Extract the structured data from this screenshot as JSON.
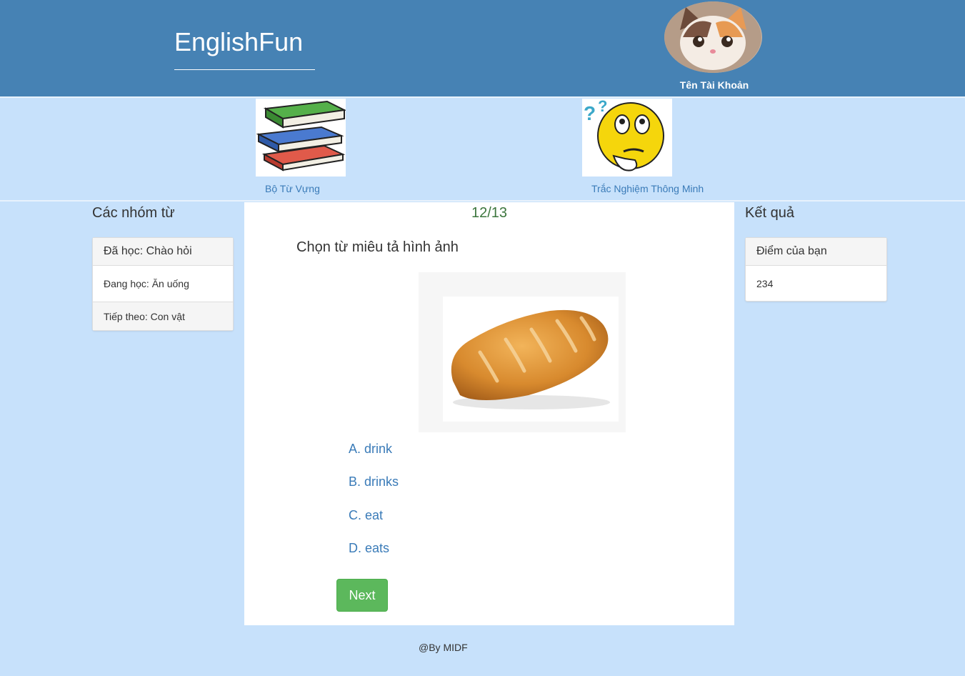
{
  "header": {
    "brand": "EnglishFun",
    "account_name": "Tên Tài Khoản"
  },
  "nav": {
    "vocab_label": "Bộ Từ Vựng",
    "quiz_label": "Trắc Nghiệm Thông Minh"
  },
  "left": {
    "title": "Các nhóm từ",
    "items": [
      "Đã học: Chào hỏi",
      "Đang học: Ăn uống",
      "Tiếp theo: Con vật"
    ]
  },
  "quiz": {
    "progress": "12/13",
    "question": "Chọn từ miêu tả hình ảnh",
    "options": [
      "A. drink",
      "B. drinks",
      "C. eat",
      "D. eats"
    ],
    "next_label": "Next"
  },
  "right": {
    "title": "Kết quả",
    "score_label": "Điểm của bạn",
    "score_value": "234"
  },
  "footer": "@By MIDF",
  "colors": {
    "header_bg": "#4682b4",
    "page_bg": "#c7e1fb",
    "link": "#3a7bb8",
    "progress": "#3c763d",
    "button": "#5cb85c"
  }
}
